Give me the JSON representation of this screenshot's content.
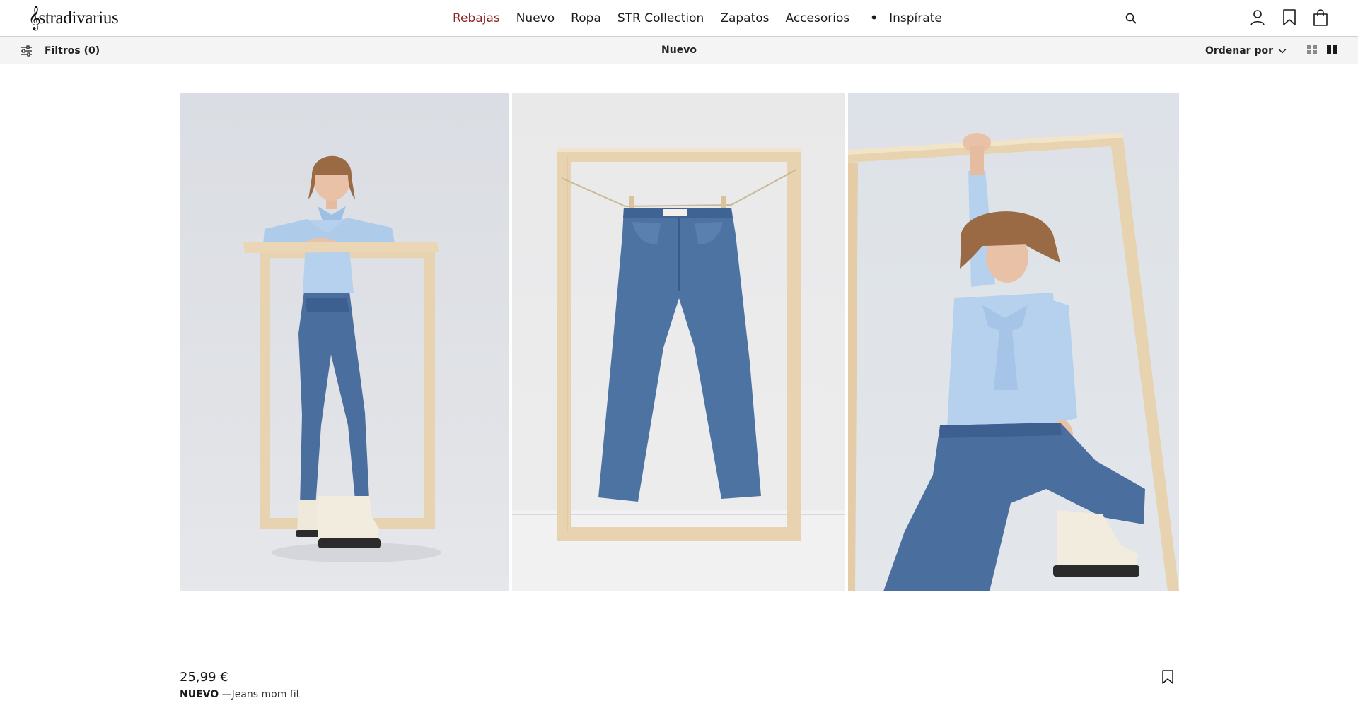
{
  "header": {
    "logo_text": "stradivarius",
    "logo_icon": "treble-clef-icon",
    "nav": [
      {
        "label": "Rebajas",
        "highlight_color": "#8b1f1f"
      },
      {
        "label": "Nuevo"
      },
      {
        "label": "Ropa"
      },
      {
        "label": "STR Collection"
      },
      {
        "label": "Zapatos"
      },
      {
        "label": "Accesorios"
      },
      {
        "label": "•"
      },
      {
        "label": "Inspírate"
      }
    ],
    "search": {
      "placeholder": "",
      "value": "",
      "icon": "search-icon"
    },
    "icons": [
      "user-icon",
      "bookmark-icon",
      "shopping-bag-icon"
    ]
  },
  "subbar": {
    "filters_label": "Filtros (0)",
    "filters_icon": "sliders-icon",
    "title": "Nuevo",
    "sort_label": "Ordenar por",
    "sort_icon": "chevron-down-icon",
    "view_icons": [
      "grid-small-icon",
      "grid-large-icon"
    ]
  },
  "product": {
    "price": "25,99 €",
    "tag": "NUEVO",
    "name": " —Jeans mom fit",
    "wishlist_icon": "bookmark-icon",
    "images": [
      "model-standing-frame-photo",
      "jeans-hanging-frame-photo",
      "model-crouching-frame-photo"
    ]
  },
  "colors": {
    "sale": "#8b1f1f",
    "denim": "#4a6f9f",
    "shirt": "#b6d1ee",
    "wood": "#e8d3b0",
    "subbar_bg": "#f4f4f4"
  }
}
